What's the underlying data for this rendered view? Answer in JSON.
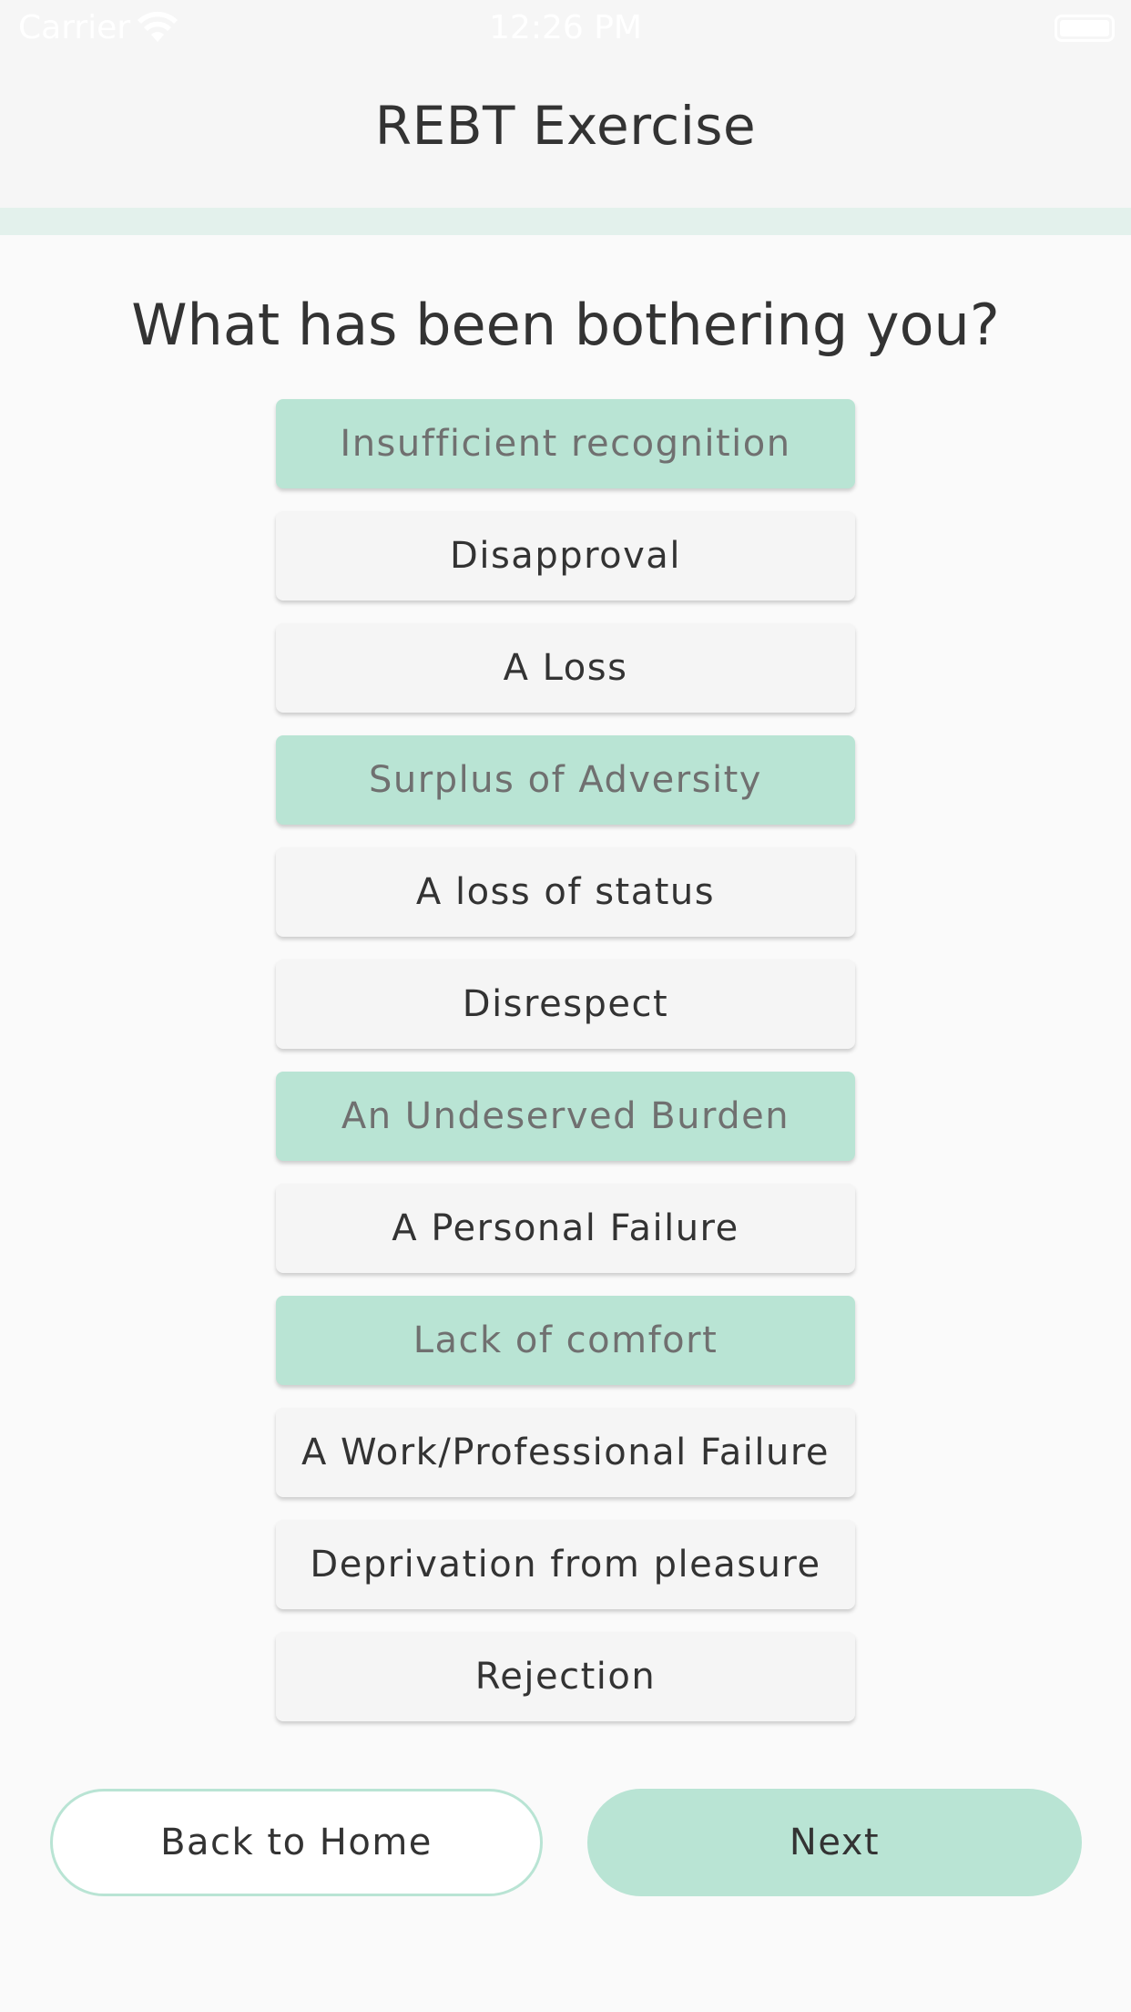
{
  "status_bar": {
    "carrier": "Carrier",
    "time": "12:26 PM",
    "wifi_icon": "wifi-icon",
    "battery_icon": "battery-icon"
  },
  "header": {
    "title": "REBT Exercise"
  },
  "progress": {
    "value": 0
  },
  "main": {
    "question": "What has been bothering you?",
    "options": [
      {
        "label": "Insufficient recognition",
        "selected": true
      },
      {
        "label": "Disapproval",
        "selected": false
      },
      {
        "label": "A Loss",
        "selected": false
      },
      {
        "label": "Surplus of Adversity",
        "selected": true
      },
      {
        "label": "A loss of status",
        "selected": false
      },
      {
        "label": "Disrespect",
        "selected": false
      },
      {
        "label": "An Undeserved Burden",
        "selected": true
      },
      {
        "label": "A Personal Failure",
        "selected": false
      },
      {
        "label": "Lack of comfort",
        "selected": true
      },
      {
        "label": "A Work/Professional Failure",
        "selected": false
      },
      {
        "label": "Deprivation from pleasure",
        "selected": false
      },
      {
        "label": "Rejection",
        "selected": false
      }
    ]
  },
  "footer": {
    "back_label": "Back to Home",
    "next_label": "Next"
  },
  "colors": {
    "accent": "#b9e4d4",
    "progress_track": "#e3f1ec",
    "background": "#fafafa",
    "option_background": "#f5f5f5",
    "text": "#333333",
    "selected_text": "#707070"
  }
}
